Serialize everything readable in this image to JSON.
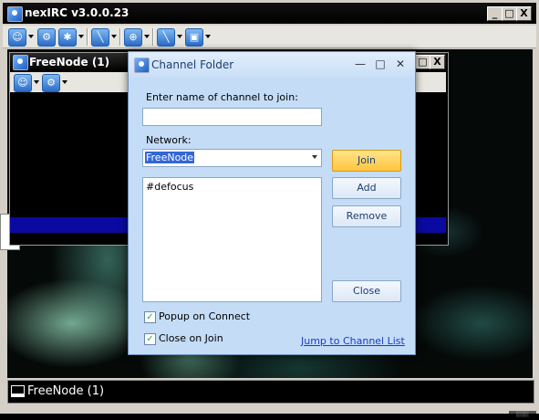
{
  "app": {
    "title": "nexIRC v3.0.0.23",
    "caption_buttons": [
      "_",
      "□",
      "X"
    ]
  },
  "child_window": {
    "title": "FreeNode (1)",
    "caption_buttons": [
      "□",
      "X"
    ]
  },
  "dialog": {
    "title": "Channel Folder",
    "caption_buttons": [
      "—",
      "□",
      "✕"
    ],
    "channel_label": "Enter name of channel to join:",
    "channel_value": "",
    "network_label": "Network:",
    "network_selected": "FreeNode",
    "channels": [
      "#defocus"
    ],
    "buttons": {
      "join": "Join",
      "add": "Add",
      "remove": "Remove",
      "close": "Close"
    },
    "options": {
      "popup_on_connect": "Popup on Connect",
      "popup_on_connect_checked": true,
      "close_on_join": "Close on Join",
      "close_on_join_checked": true
    },
    "jump_link": "Jump to Channel List"
  },
  "status_bar": {
    "label": "FreeNode (1)"
  },
  "colors": {
    "dialog_bg": "#c4dcf6",
    "join_button": "#ffc43d",
    "link": "#1a3dc8",
    "child_bar": "#0a0aa0"
  }
}
